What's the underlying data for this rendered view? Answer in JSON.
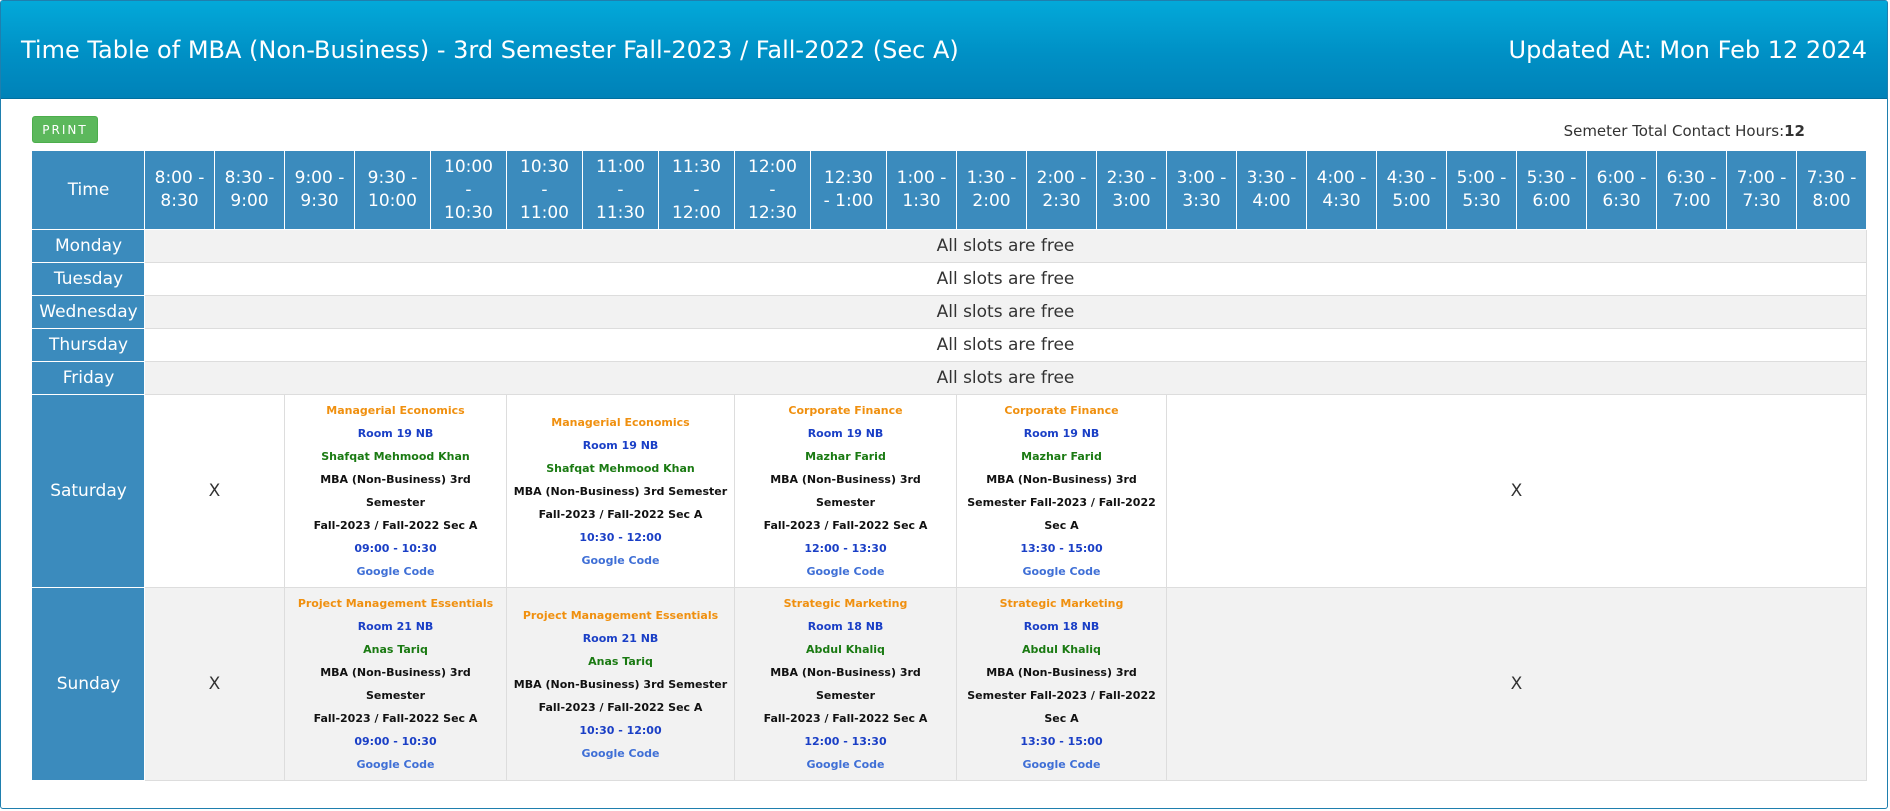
{
  "header": {
    "title": "Time Table of MBA (Non-Business) - 3rd Semester Fall-2023 / Fall-2022 (Sec A)",
    "updated": "Updated At: Mon Feb 12 2024"
  },
  "toolbar": {
    "print_label": "PRINT",
    "hours_label": "Semeter Total Contact Hours:",
    "hours_value": "12"
  },
  "table": {
    "time_header": "Time",
    "time_slots": [
      [
        "8:00 -",
        "8:30"
      ],
      [
        "8:30 -",
        "9:00"
      ],
      [
        "9:00 -",
        "9:30"
      ],
      [
        "9:30 -",
        "10:00"
      ],
      [
        "10:00",
        "-",
        "10:30"
      ],
      [
        "10:30",
        "-",
        "11:00"
      ],
      [
        "11:00",
        "-",
        "11:30"
      ],
      [
        "11:30",
        "-",
        "12:00"
      ],
      [
        "12:00",
        "-",
        "12:30"
      ],
      [
        "12:30",
        "- 1:00"
      ],
      [
        "1:00 -",
        "1:30"
      ],
      [
        "1:30 -",
        "2:00"
      ],
      [
        "2:00 -",
        "2:30"
      ],
      [
        "2:30 -",
        "3:00"
      ],
      [
        "3:00 -",
        "3:30"
      ],
      [
        "3:30 -",
        "4:00"
      ],
      [
        "4:00 -",
        "4:30"
      ],
      [
        "4:30 -",
        "5:00"
      ],
      [
        "5:00 -",
        "5:30"
      ],
      [
        "5:30 -",
        "6:00"
      ],
      [
        "6:00 -",
        "6:30"
      ],
      [
        "6:30 -",
        "7:00"
      ],
      [
        "7:00 -",
        "7:30"
      ],
      [
        "7:30 -",
        "8:00"
      ]
    ],
    "free_days": [
      {
        "day": "Monday",
        "text": "All slots are free"
      },
      {
        "day": "Tuesday",
        "text": "All slots are free"
      },
      {
        "day": "Wednesday",
        "text": "All slots are free"
      },
      {
        "day": "Thursday",
        "text": "All slots are free"
      },
      {
        "day": "Friday",
        "text": "All slots are free"
      }
    ],
    "saturday": {
      "day": "Saturday",
      "empty_mark": "X",
      "classes": [
        {
          "course": "Managerial Economics",
          "room": "Room 19 NB",
          "teacher": "Shafqat Mehmood Khan",
          "section": [
            "MBA (Non-Business) 3rd Semester",
            "Fall-2023 / Fall-2022 Sec A"
          ],
          "time": "09:00 - 10:30",
          "code": "Google Code"
        },
        {
          "course": "Managerial Economics",
          "room": "Room 19 NB",
          "teacher": "Shafqat Mehmood Khan",
          "section": [
            "MBA (Non-Business) 3rd Semester",
            "Fall-2023 / Fall-2022 Sec A"
          ],
          "time": "10:30 - 12:00",
          "code": "Google Code"
        },
        {
          "course": "Corporate Finance",
          "room": "Room 19 NB",
          "teacher": "Mazhar Farid",
          "section": [
            "MBA (Non-Business) 3rd Semester",
            "Fall-2023 / Fall-2022 Sec A"
          ],
          "time": "12:00 - 13:30",
          "code": "Google Code"
        },
        {
          "course": "Corporate Finance",
          "room": "Room 19 NB",
          "teacher": "Mazhar Farid",
          "section": [
            "MBA (Non-Business) 3rd",
            "Semester Fall-2023 / Fall-2022",
            "Sec A"
          ],
          "time": "13:30 - 15:00",
          "code": "Google Code"
        }
      ]
    },
    "sunday": {
      "day": "Sunday",
      "empty_mark": "X",
      "classes": [
        {
          "course": "Project Management Essentials",
          "room": "Room 21 NB",
          "teacher": "Anas Tariq",
          "section": [
            "MBA (Non-Business) 3rd Semester",
            "Fall-2023 / Fall-2022 Sec A"
          ],
          "time": "09:00 - 10:30",
          "code": "Google Code"
        },
        {
          "course": "Project Management Essentials",
          "room": "Room 21 NB",
          "teacher": "Anas Tariq",
          "section": [
            "MBA (Non-Business) 3rd Semester",
            "Fall-2023 / Fall-2022 Sec A"
          ],
          "time": "10:30 - 12:00",
          "code": "Google Code"
        },
        {
          "course": "Strategic Marketing",
          "room": "Room 18 NB",
          "teacher": "Abdul Khaliq",
          "section": [
            "MBA (Non-Business) 3rd Semester",
            "Fall-2023 / Fall-2022 Sec A"
          ],
          "time": "12:00 - 13:30",
          "code": "Google Code"
        },
        {
          "course": "Strategic Marketing",
          "room": "Room 18 NB",
          "teacher": "Abdul Khaliq",
          "section": [
            "MBA (Non-Business) 3rd",
            "Semester Fall-2023 / Fall-2022",
            "Sec A"
          ],
          "time": "13:30 - 15:00",
          "code": "Google Code"
        }
      ]
    }
  }
}
